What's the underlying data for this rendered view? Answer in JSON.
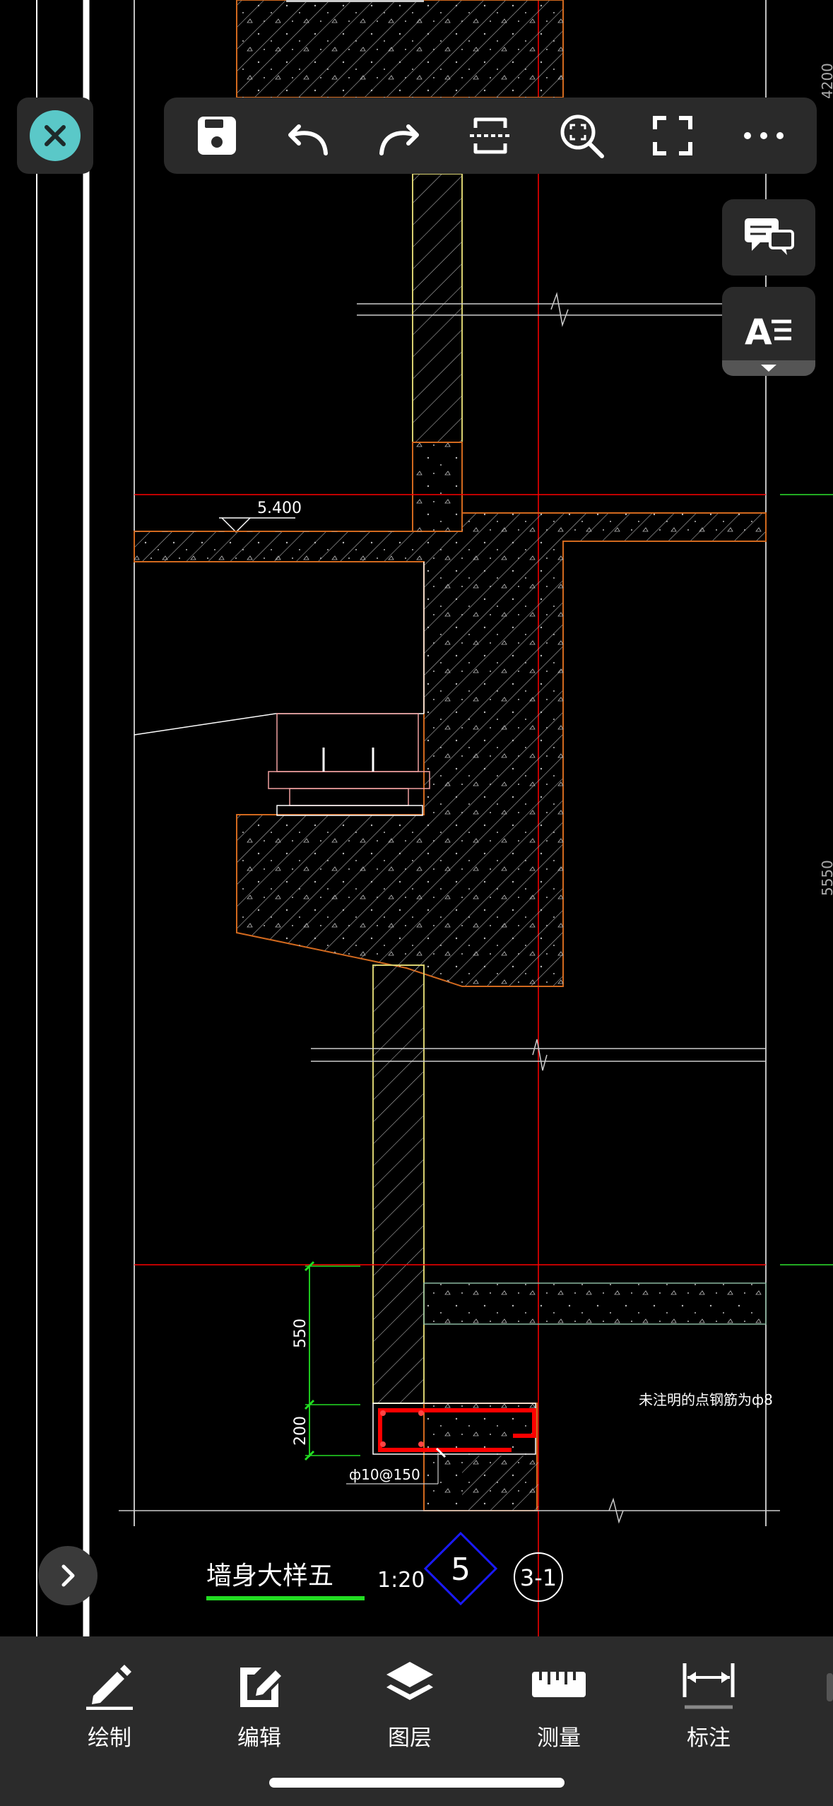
{
  "drawing": {
    "elevation_mark": "5.400",
    "dim_550": "550",
    "dim_200": "200",
    "rebar_label": "ф10@150",
    "note": "未注明的点钢筋为ф8",
    "title": "墙身大样五",
    "scale": "1:20",
    "detail_number": "5",
    "sheet_ref": "3-1",
    "right_dim_top": "4200",
    "right_dim_mid": "5550"
  },
  "toolbar": {
    "items": [
      "save-icon",
      "undo-icon",
      "redo-icon",
      "section-icon",
      "zoom-fit-icon",
      "fullscreen-icon",
      "more-icon"
    ]
  },
  "bottom_tabs": [
    {
      "label": "绘制",
      "icon": "pencil-icon"
    },
    {
      "label": "编辑",
      "icon": "edit-icon"
    },
    {
      "label": "图层",
      "icon": "layers-icon"
    },
    {
      "label": "测量",
      "icon": "ruler-icon"
    },
    {
      "label": "标注",
      "icon": "dimension-icon"
    }
  ],
  "colors": {
    "accent": "#5ac8c8",
    "cad_green": "#22dd22",
    "cad_red": "#ff0000",
    "cad_blue": "#1a1aff",
    "concrete_edge": "#d2691e",
    "yellow_line": "#d8d070"
  }
}
